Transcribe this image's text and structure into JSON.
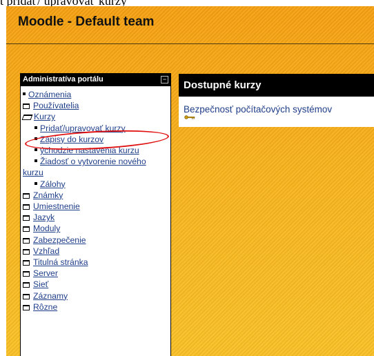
{
  "caption": "t pridať/ upravovať kurzy",
  "site": {
    "title": "Moodle - Default team"
  },
  "admin_block": {
    "title": "Administratíva portálu",
    "collapse_icon": "minus-icon",
    "items": [
      {
        "label": "Oznámenia",
        "icon": "bullet"
      },
      {
        "label": "Používatelia",
        "icon": "folder-icon"
      },
      {
        "label": "Kurzy",
        "icon": "open-folder-icon"
      },
      {
        "label": "Pridať/upravovať kurzy",
        "icon": "bullet"
      },
      {
        "label": "Zápisy do kurzov",
        "icon": "bullet"
      },
      {
        "label": "ýchodzie nastavenia kurzu",
        "icon": "bullet"
      },
      {
        "label": "Žiadosť o vytvorenie nového kurzu",
        "icon": "bullet"
      },
      {
        "label": "Zálohy",
        "icon": "bullet"
      },
      {
        "label": "Známky",
        "icon": "folder-icon"
      },
      {
        "label": "Umiestnenie",
        "icon": "folder-icon"
      },
      {
        "label": "Jazyk",
        "icon": "folder-icon"
      },
      {
        "label": "Moduly",
        "icon": "folder-icon"
      },
      {
        "label": "Zabezpečenie",
        "icon": "folder-icon"
      },
      {
        "label": "Vzhľad",
        "icon": "folder-icon"
      },
      {
        "label": "Titulná stránka",
        "icon": "folder-icon"
      },
      {
        "label": "Server",
        "icon": "folder-icon"
      },
      {
        "label": "Sieť",
        "icon": "folder-icon"
      },
      {
        "label": "Záznamy",
        "icon": "folder-icon"
      },
      {
        "label": "Rôzne",
        "icon": "folder-icon"
      }
    ]
  },
  "courses_block": {
    "title": "Dostupné kurzy",
    "courses": [
      {
        "name": "Bezpečnosť počítačových systémov",
        "icon": "key-icon"
      }
    ]
  },
  "colors": {
    "accent_orange": "#f7b21a",
    "link": "#1f3e8a",
    "highlight": "#e01010"
  }
}
